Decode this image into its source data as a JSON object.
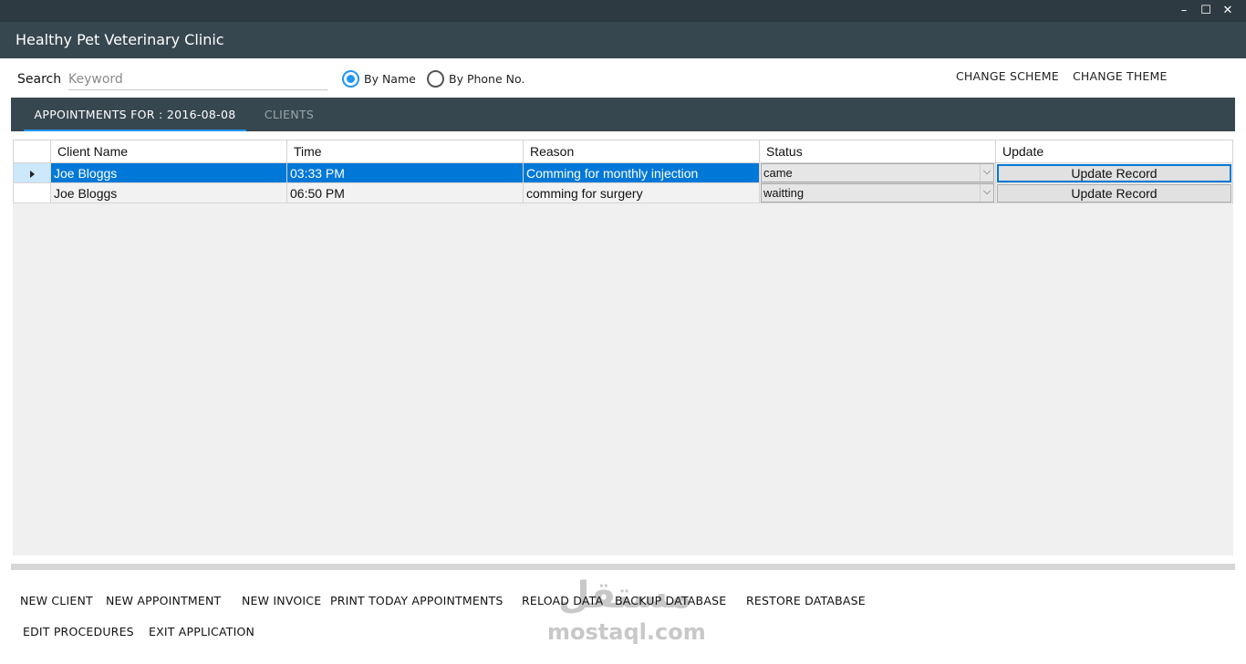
{
  "app": {
    "title": "Healthy Pet Veterinary Clinic"
  },
  "window_controls": {
    "minimize": "–",
    "maximize": "☐",
    "close": "✕"
  },
  "search": {
    "label": "Search",
    "placeholder": "Keyword",
    "value": ""
  },
  "search_mode": {
    "options": [
      {
        "label": "By Name",
        "selected": true
      },
      {
        "label": "By Phone No.",
        "selected": false
      }
    ]
  },
  "header_links": {
    "change_scheme": "CHANGE SCHEME",
    "change_theme": "CHANGE THEME"
  },
  "tabs": [
    {
      "label": "APPOINTMENTS FOR : 2016-08-08",
      "active": true
    },
    {
      "label": "CLIENTS",
      "active": false
    }
  ],
  "grid": {
    "columns": [
      "Client Name",
      "Time",
      "Reason",
      "Status",
      "Update"
    ],
    "rows": [
      {
        "client": "Joe Bloggs",
        "time": "03:33 PM",
        "reason": "Comming for monthly injection",
        "status": "came",
        "update": "Update Record",
        "selected": true
      },
      {
        "client": "Joe Bloggs",
        "time": "06:50 PM",
        "reason": "comming for surgery",
        "status": "waitting",
        "update": "Update Record",
        "selected": false
      }
    ]
  },
  "actions": {
    "new_client": "NEW CLIENT",
    "new_appointment": "NEW APPOINTMENT",
    "new_invoice": "NEW INVOICE",
    "print_today": "PRINT TODAY APPOINTMENTS",
    "reload_data": "RELOAD DATA",
    "backup_db": "BACKUP DATABASE",
    "restore_db": "RESTORE DATABASE",
    "edit_procedures": "EDIT PROCEDURES",
    "exit_app": "EXIT APPLICATION"
  },
  "watermark": {
    "arabic": "مستقل",
    "latin": "mostaql.com"
  },
  "colors": {
    "header": "#37474f",
    "accent": "#2196f3",
    "selection": "#0078d7"
  }
}
